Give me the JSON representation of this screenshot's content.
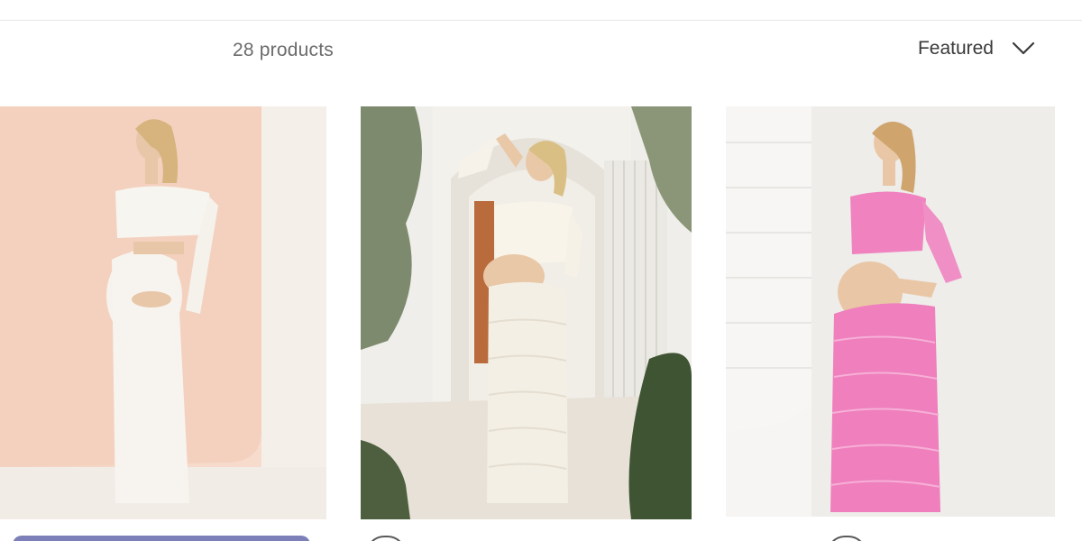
{
  "toolbar": {
    "count_text": "28 products",
    "sort_label": "Featured"
  },
  "icons": {
    "sort_chevron": "chevron-down-icon"
  },
  "products": [
    {
      "image_desc": "woman in white off-shoulder crop top and maxi skirt",
      "accent": "#f4d2c1"
    },
    {
      "image_desc": "woman in white ruffle top and sheer tiered skirt",
      "accent": "#ece8dc"
    },
    {
      "image_desc": "woman in pink off-shoulder top and maxi skirt",
      "accent": "#ee7fbe"
    }
  ],
  "colors": {
    "text_muted": "#6b6b6b",
    "text_dark": "#3a3a3a",
    "button_partial": "#7d7fb8"
  }
}
